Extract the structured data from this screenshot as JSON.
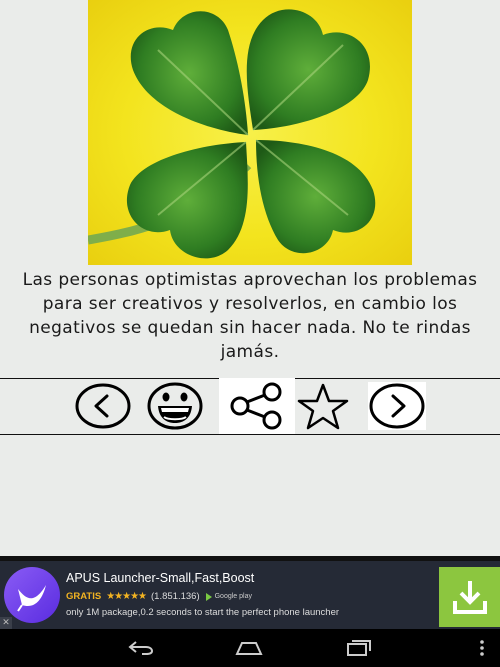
{
  "quote": {
    "text": "Las personas optimistas aprovechan los problemas para ser creativos y resolverlos, en cambio los negativos se quedan sin hacer nada. No te rindas jamás."
  },
  "toolbar": {
    "items": [
      {
        "icon": "chevron-left-icon"
      },
      {
        "icon": "laughing-face-icon"
      },
      {
        "icon": "share-icon"
      },
      {
        "icon": "star-outline-icon"
      },
      {
        "icon": "chevron-right-icon"
      }
    ]
  },
  "ad": {
    "title": "APUS Launcher-Small,Fast,Boost",
    "badge": "GRATIS",
    "stars": "★★★★★",
    "rating_count": "(1.851.136)",
    "store_label": "Google play",
    "description": "only 1M package,0.2 seconds to start the perfect phone launcher",
    "close_label": "✕",
    "accent_color": "#8cc63f"
  },
  "navbar": {
    "items": [
      "back-icon",
      "home-icon",
      "recents-icon",
      "menu-icon"
    ]
  }
}
